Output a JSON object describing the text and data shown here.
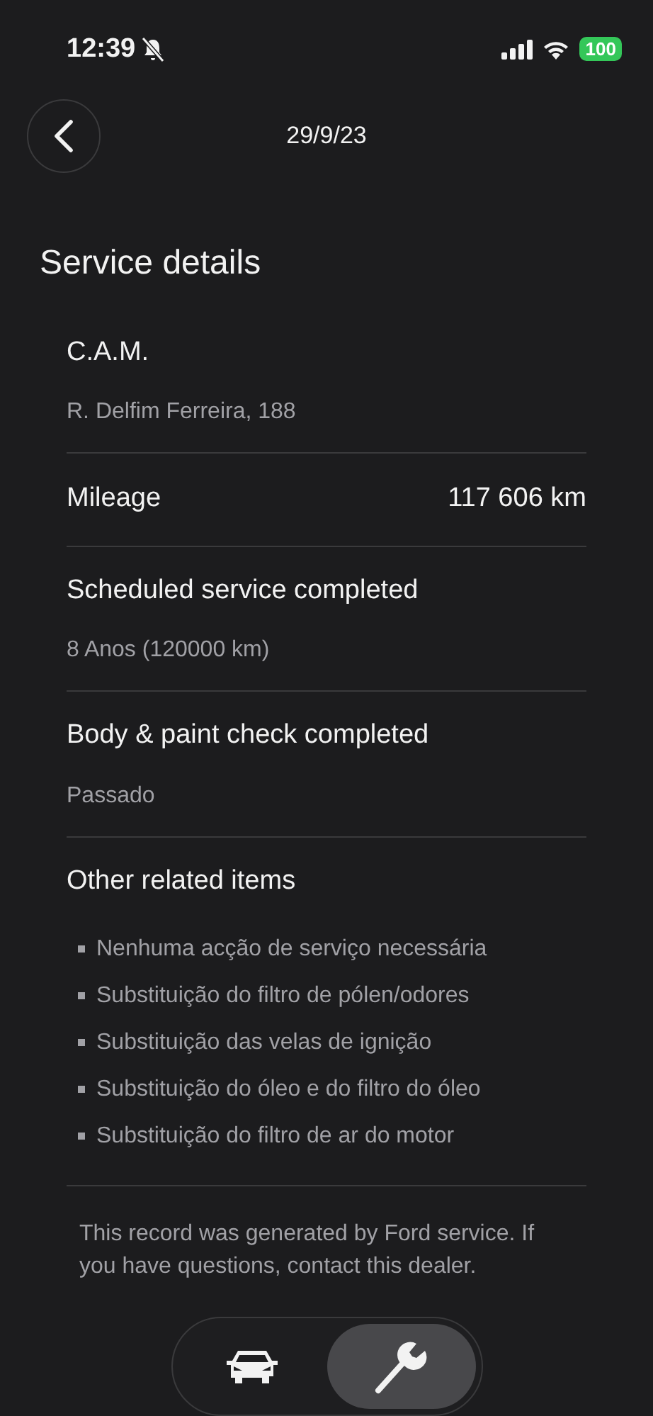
{
  "status_bar": {
    "time": "12:39",
    "battery": "100"
  },
  "header": {
    "title": "29/9/23"
  },
  "heading": "Service details",
  "sections": [
    {
      "kind": "detail",
      "title": "C.A.M.",
      "subtitle": "R. Delfim Ferreira, 188"
    },
    {
      "kind": "value",
      "title": "Mileage",
      "value": "117 606 km"
    },
    {
      "kind": "detail",
      "title": "Scheduled service completed",
      "subtitle": "8 Anos (120000 km)"
    },
    {
      "kind": "detail",
      "title": "Body & paint check completed",
      "subtitle": "Passado"
    },
    {
      "kind": "list",
      "title": "Other related items",
      "items": [
        "Nenhuma acção de serviço necessária",
        "Substituição do filtro de pólen/odores",
        "Substituição das velas de ignição",
        "Substituição do óleo e do filtro do óleo",
        "Substituição do filtro de ar do motor"
      ]
    }
  ],
  "footer": "This record was generated by Ford service. If you have questions, contact this dealer.",
  "tabs": [
    {
      "kind": "car",
      "selected": false
    },
    {
      "kind": "wrench",
      "selected": true
    }
  ]
}
